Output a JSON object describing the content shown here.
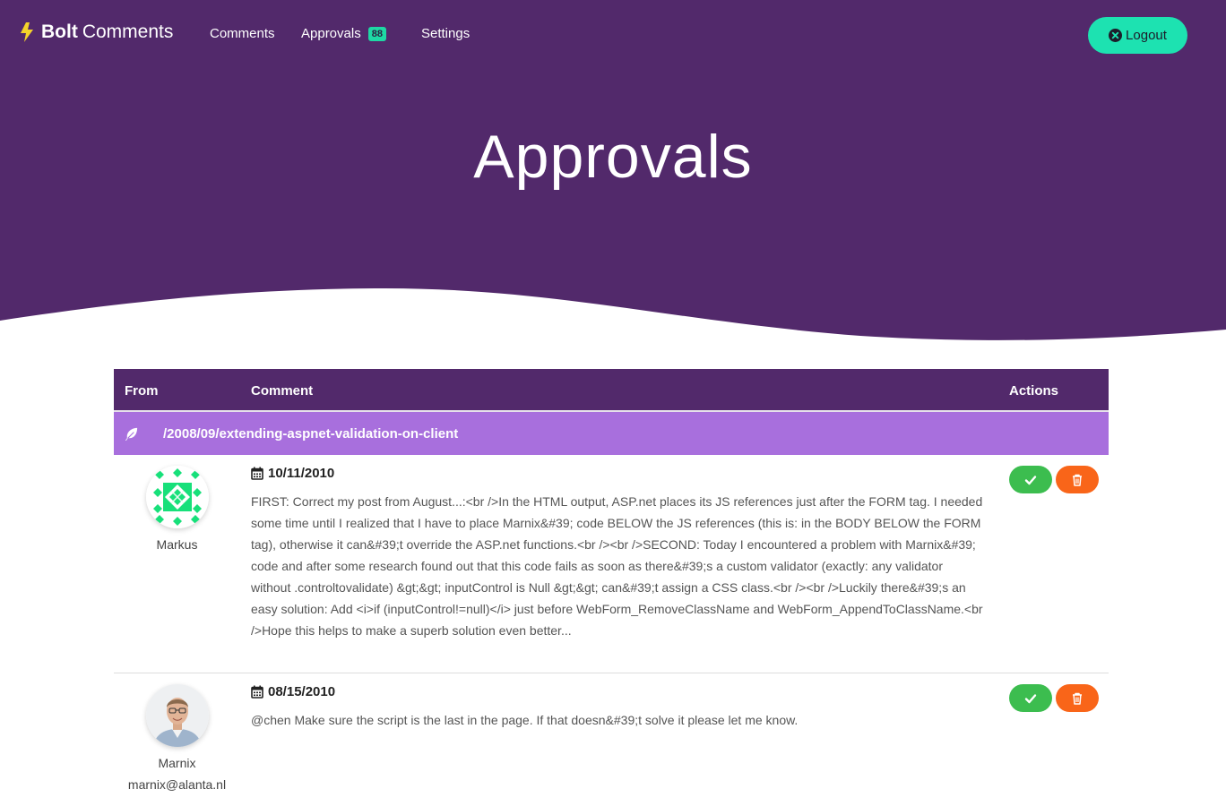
{
  "brand": {
    "bold": "Bolt",
    "regular": "Comments"
  },
  "nav": {
    "comments": "Comments",
    "approvals": "Approvals",
    "approvals_badge": "88",
    "settings": "Settings"
  },
  "logout": {
    "label": "Logout",
    "icon": "times-circle-icon"
  },
  "hero": {
    "title": "Approvals"
  },
  "table": {
    "headers": {
      "from": "From",
      "comment": "Comment",
      "actions": "Actions"
    },
    "group": {
      "icon": "feather-icon",
      "path": "/2008/09/extending-aspnet-validation-on-client"
    },
    "rows": [
      {
        "name": "Markus",
        "email": "",
        "date": "10/11/2010",
        "text": "FIRST: Correct my post from August...:<br />In the HTML output, ASP.net places its JS references just after the FORM tag. I needed some time until I realized that I have to place Marnix&#39; code BELOW the JS references (this is: in the BODY BELOW the FORM tag), otherwise it can&#39;t override the ASP.net functions.<br /><br />SECOND: Today I encountered a problem with Marnix&#39; code and after some research found out that this code fails as soon as there&#39;s a custom validator (exactly: any validator without .controltovalidate) &gt;&gt; inputControl is Null &gt;&gt; can&#39;t assign a CSS class.<br /><br />Luckily there&#39;s an easy solution: Add <i>if (inputControl!=null)</i> just before WebForm_RemoveClassName and WebForm_AppendToClassName.<br />Hope this helps to make a superb solution even better..."
      },
      {
        "name": "Marnix",
        "email": "marnix@alanta.nl",
        "date": "08/15/2010",
        "text": "@chen Make sure the script is the last in the page. If that doesn&#39;t solve it please let me know."
      }
    ]
  },
  "colors": {
    "header_purple": "#52296b",
    "group_purple": "#a86fdd",
    "accent_teal": "#1de2b1",
    "approve_green": "#3cbd4f",
    "delete_orange": "#f96519"
  }
}
